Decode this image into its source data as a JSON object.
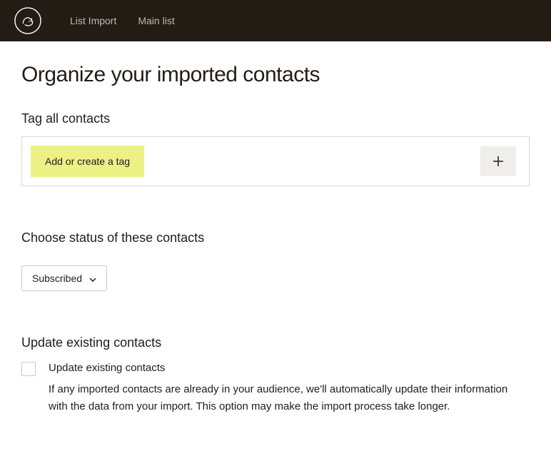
{
  "nav": {
    "items": [
      "List Import",
      "Main list"
    ]
  },
  "page": {
    "title": "Organize your imported contacts"
  },
  "tag_section": {
    "heading": "Tag all contacts",
    "chip_label": "Add or create a tag"
  },
  "status_section": {
    "heading": "Choose status of these contacts",
    "selected": "Subscribed"
  },
  "update_section": {
    "heading": "Update existing contacts",
    "checkbox_label": "Update existing contacts",
    "description": "If any imported contacts are already in your audience, we'll automatically update their information with the data from your import. This option may make the import process take longer."
  }
}
